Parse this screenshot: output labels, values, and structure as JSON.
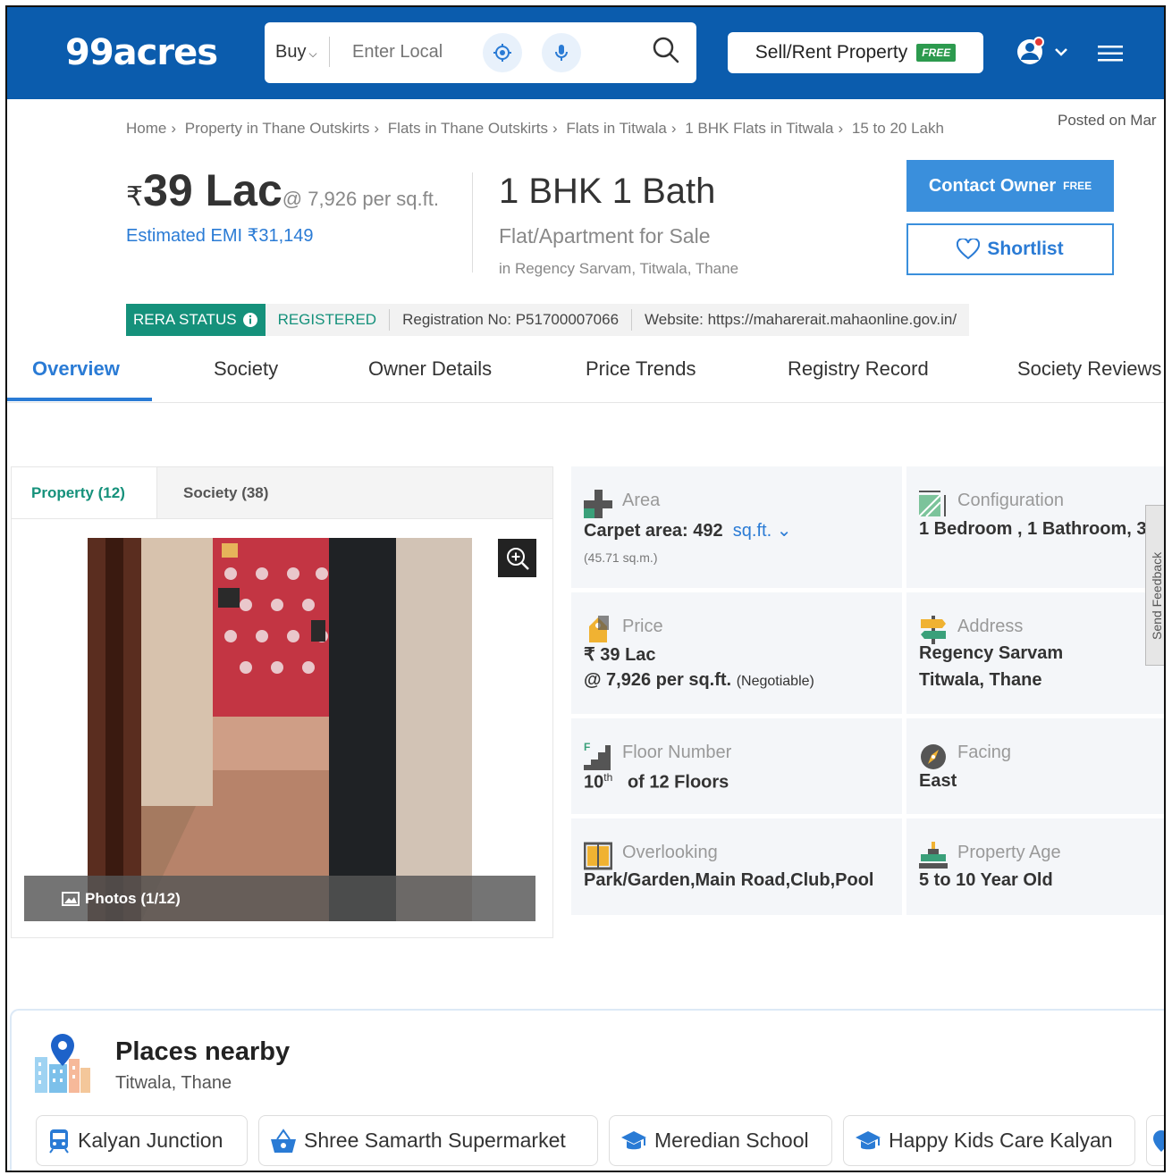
{
  "header": {
    "logo": "99acres",
    "buy_label": "Buy",
    "search_placeholder": "Enter Local",
    "sell_label": "Sell/Rent Property",
    "free_badge": "FREE"
  },
  "breadcrumb": {
    "items": [
      "Home",
      "Property in Thane Outskirts",
      "Flats in Thane Outskirts",
      "Flats in Titwala",
      "1 BHK Flats in Titwala",
      "15 to 20 Lakh"
    ],
    "separator": "›",
    "posted": "Posted on Mar"
  },
  "listing": {
    "currency": "₹",
    "price": "39 Lac",
    "per_sqft": "@ 7,926 per sq.ft.",
    "emi": "Estimated EMI ₹31,149",
    "config": "1 BHK 1 Bath",
    "type": "Flat/Apartment for Sale",
    "location": "in Regency Sarvam, Titwala, Thane",
    "contact_label": "Contact Owner",
    "contact_badge": "FREE",
    "shortlist_label": "Shortlist"
  },
  "rera": {
    "status_label": "RERA STATUS",
    "status_value": "REGISTERED",
    "registration": "Registration No: P51700007066",
    "website": "Website: https://maharerait.mahaonline.gov.in/"
  },
  "tabs": [
    "Overview",
    "Society",
    "Owner Details",
    "Price Trends",
    "Registry Record",
    "Society Reviews"
  ],
  "gallery": {
    "tab_property": "Property (12)",
    "tab_society": "Society (38)",
    "photos_label": "Photos (1/12)"
  },
  "details": {
    "area": {
      "label": "Area",
      "value": "Carpet area: 492",
      "unit": "sq.ft.",
      "sub": "(45.71 sq.m.)"
    },
    "configuration": {
      "label": "Configuration",
      "value": "1 Bedroom , 1 Bathroom, 3"
    },
    "price": {
      "label": "Price",
      "value": "₹ 39 Lac",
      "value2": "@ 7,926 per sq.ft.",
      "note": "(Negotiable)"
    },
    "address": {
      "label": "Address",
      "line1": "Regency Sarvam",
      "line2": "Titwala, Thane"
    },
    "floor": {
      "label": "Floor Number",
      "floor": "10",
      "suffix": "th",
      "of": "of 12 Floors"
    },
    "facing": {
      "label": "Facing",
      "value": "East"
    },
    "overlooking": {
      "label": "Overlooking",
      "value": "Park/Garden,Main Road,Club,Pool"
    },
    "age": {
      "label": "Property Age",
      "value": "5 to 10 Year Old"
    }
  },
  "feedback": "Send Feedback",
  "places": {
    "title": "Places nearby",
    "subtitle": "Titwala, Thane",
    "items": [
      "Kalyan Junction",
      "Shree Samarth Supermarket",
      "Meredian School",
      "Happy Kids Care Kalyan"
    ]
  },
  "colors": {
    "brand": "#0b5cad",
    "accent": "#2a7bd5",
    "rera_green": "#15917b",
    "free_green": "#2c9a4e"
  }
}
